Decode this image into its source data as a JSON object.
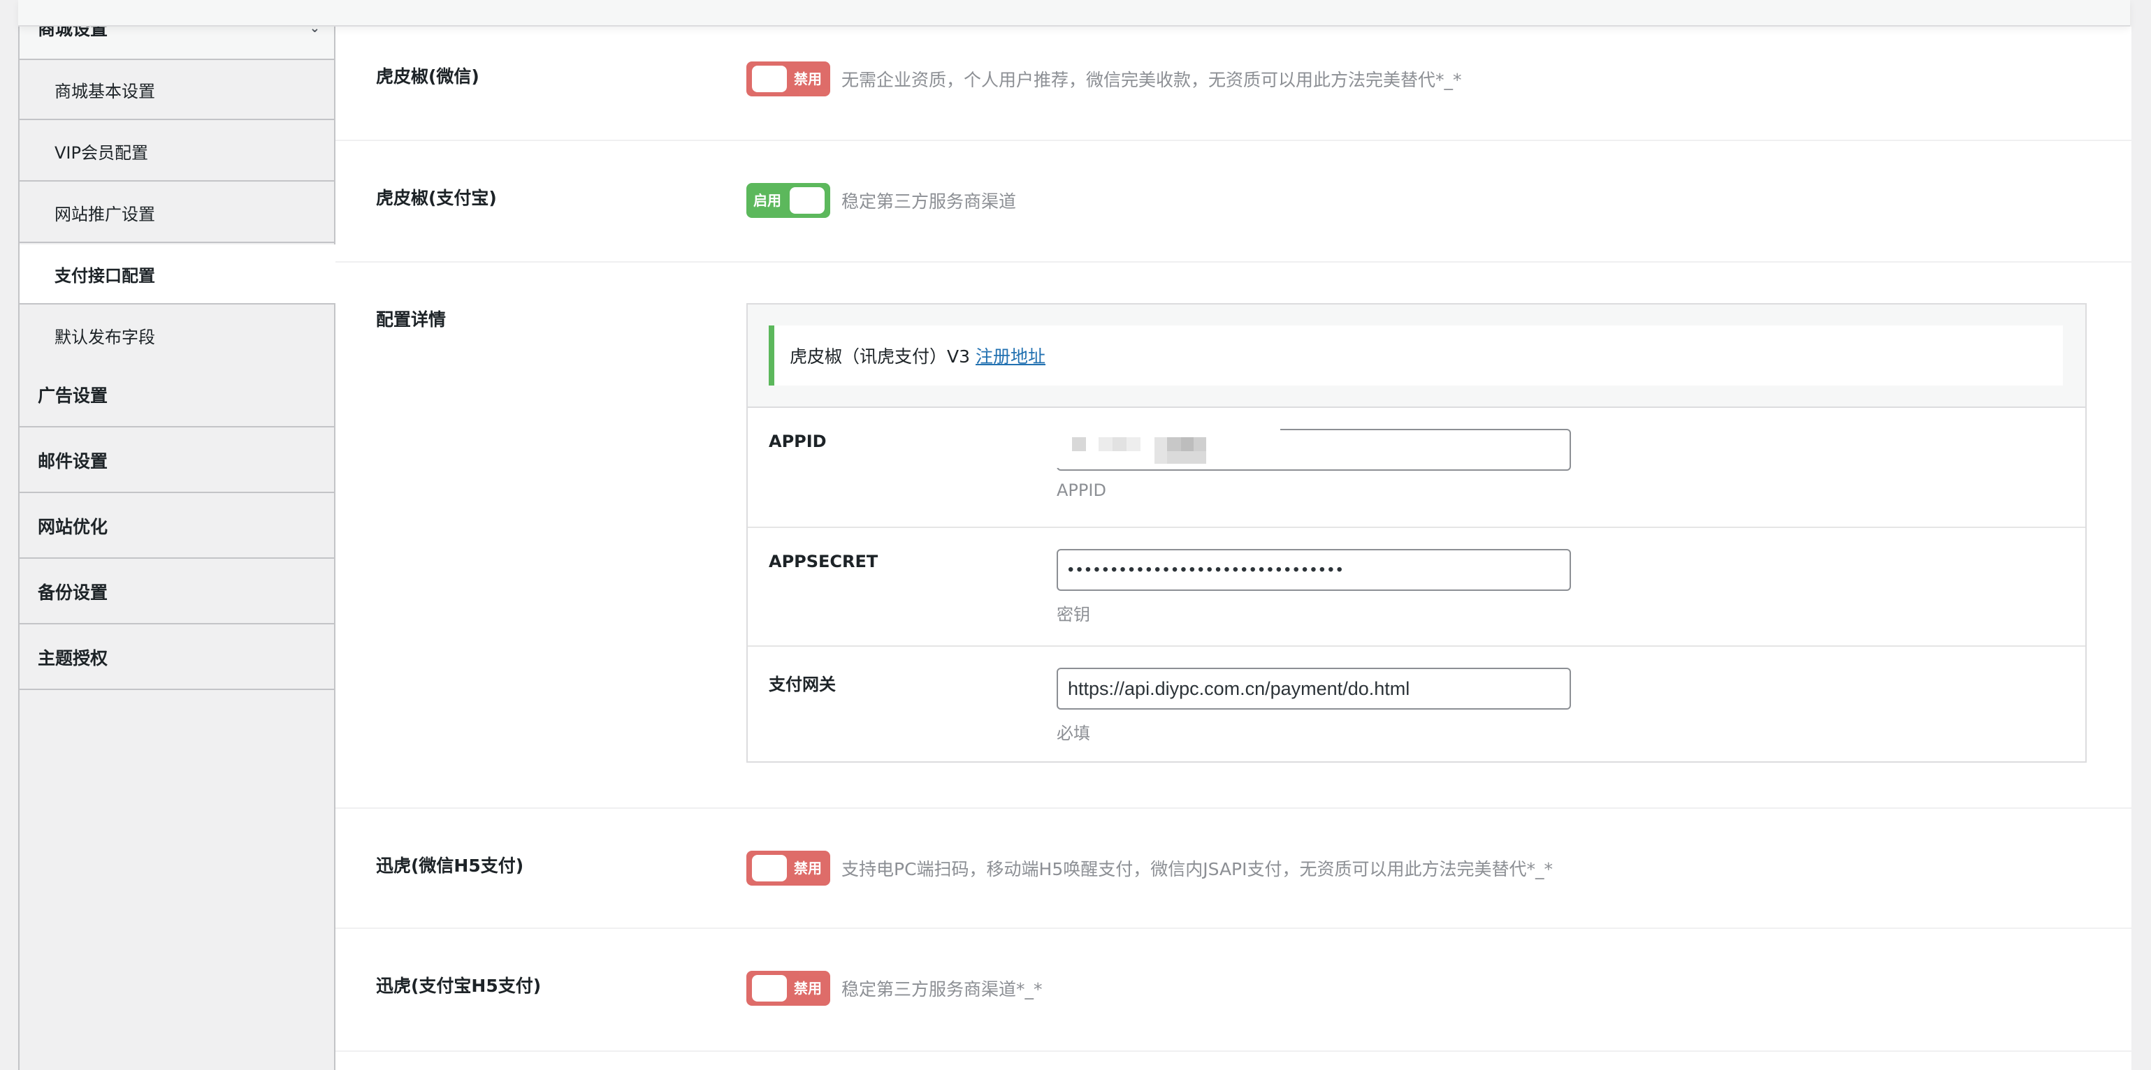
{
  "sidebar": {
    "parent_group": "商城设置",
    "sub_items": [
      {
        "label": "商城基本设置"
      },
      {
        "label": "VIP会员配置"
      },
      {
        "label": "网站推广设置"
      },
      {
        "label": "支付接口配置",
        "active": true
      },
      {
        "label": "默认发布字段"
      }
    ],
    "groups": [
      {
        "label": "广告设置"
      },
      {
        "label": "邮件设置"
      },
      {
        "label": "网站优化"
      },
      {
        "label": "备份设置"
      },
      {
        "label": "主题授权"
      }
    ]
  },
  "payments": [
    {
      "label": "虎皮椒(微信)",
      "state": "禁用",
      "enabled": false,
      "desc": "无需企业资质，个人用户推荐，微信完美收款，无资质可以用此方法完美替代*_*"
    },
    {
      "label": "虎皮椒(支付宝)",
      "state": "启用",
      "enabled": true,
      "desc": "稳定第三方服务商渠道"
    },
    {
      "label": "迅虎(微信H5支付)",
      "state": "禁用",
      "enabled": false,
      "desc": "支持电PC端扫码，移动端H5唤醒支付，微信内JSAPI支付，无资质可以用此方法完美替代*_*"
    },
    {
      "label": "迅虎(支付宝H5支付)",
      "state": "禁用",
      "enabled": false,
      "desc": "稳定第三方服务商渠道*_*"
    }
  ],
  "config": {
    "label": "配置详情",
    "notice_text": "虎皮椒（讯虎支付）V3",
    "notice_link": "注册地址",
    "fields": [
      {
        "label": "APPID",
        "value": "",
        "hint": "APPID"
      },
      {
        "label": "APPSECRET",
        "value": "••••••••••••••••••••••••••••••••",
        "hint": "密钥"
      },
      {
        "label": "支付网关",
        "value": "https://api.diypc.com.cn/payment/do.html",
        "hint": "必填"
      }
    ]
  },
  "colors": {
    "enabled": "#5cb85c",
    "disabled": "#d9534f",
    "link": "#2271b1"
  }
}
